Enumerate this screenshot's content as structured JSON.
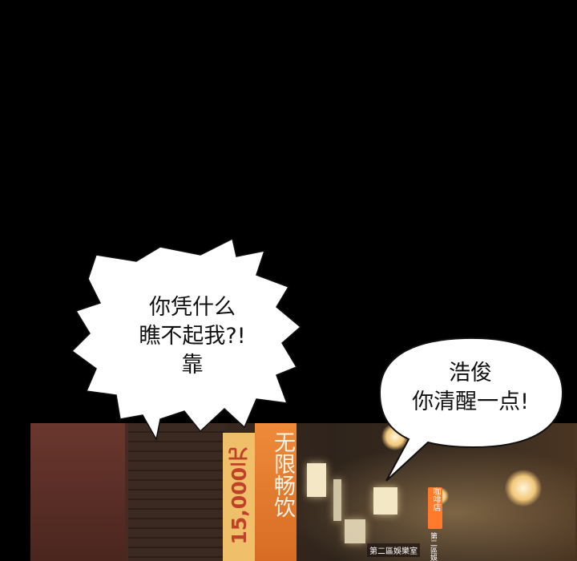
{
  "bubble_left": {
    "lines": [
      "你凭什么",
      "瞧不起我?!",
      "靠"
    ]
  },
  "bubble_right": {
    "lines": [
      "浩俊",
      "你清醒一点!"
    ]
  },
  "signs": {
    "orange_vertical": "无限畅饮",
    "price_strip": "15,000元",
    "neon_vertical": "咖啡店",
    "shop_label": "第二區娛樂室",
    "small_vertical": "第二區娛"
  }
}
